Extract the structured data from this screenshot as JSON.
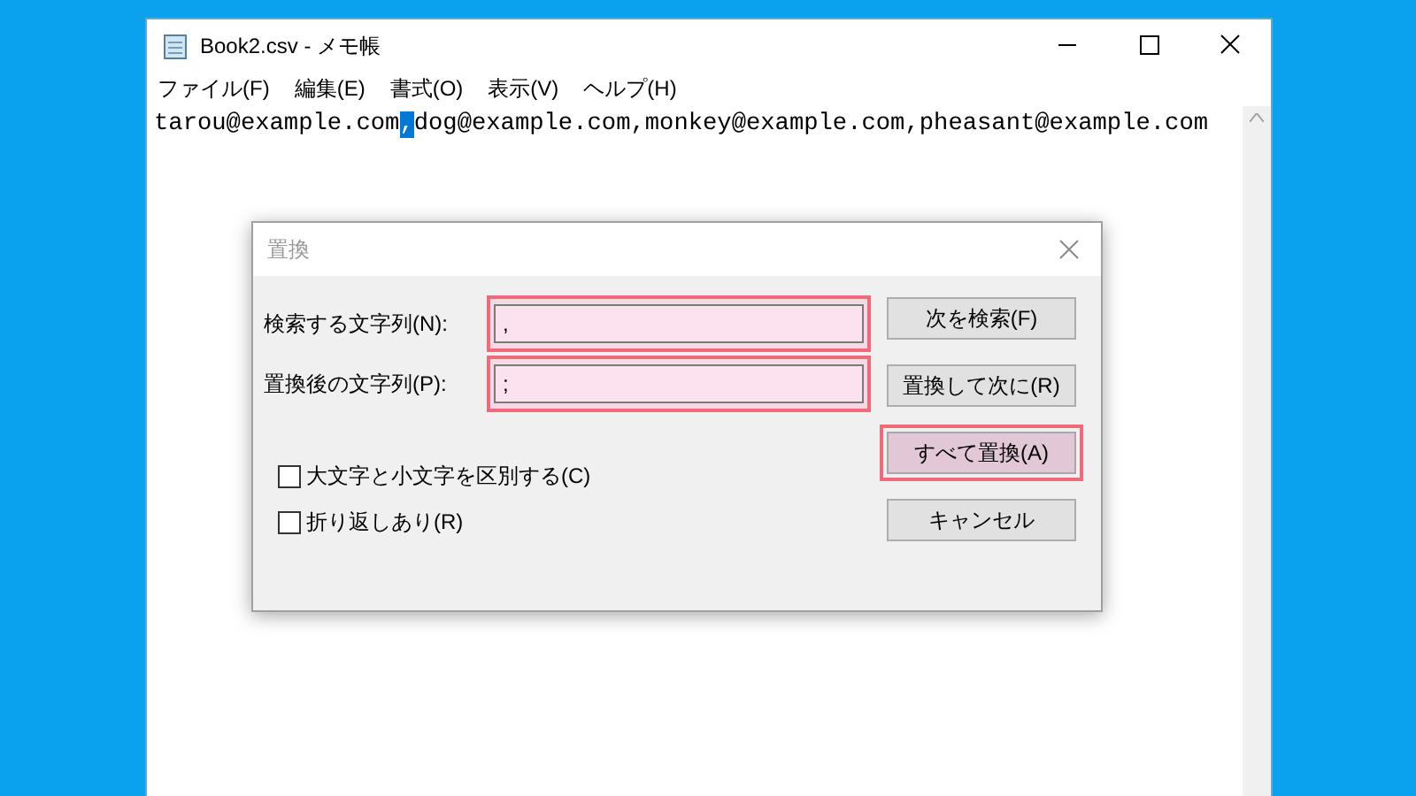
{
  "window": {
    "title": "Book2.csv - メモ帳"
  },
  "menu": [
    {
      "label": "ファイル(F)"
    },
    {
      "label": "編集(E)"
    },
    {
      "label": "書式(O)"
    },
    {
      "label": "表示(V)"
    },
    {
      "label": "ヘルプ(H)"
    }
  ],
  "editor": {
    "text_before": "tarou@example.com",
    "selection": ",",
    "text_after": "dog@example.com,monkey@example.com,pheasant@example.com"
  },
  "dialog": {
    "title": "置換",
    "fields": [
      {
        "label": "検索する文字列(N):",
        "value": ",",
        "highlighted": true
      },
      {
        "label": "置換後の文字列(P):",
        "value": ";",
        "highlighted": true
      }
    ],
    "buttons": [
      {
        "label": "次を検索(F)",
        "highlighted": false
      },
      {
        "label": "置換して次に(R)",
        "highlighted": false
      },
      {
        "label": "すべて置換(A)",
        "highlighted": true
      },
      {
        "label": "キャンセル",
        "highlighted": false
      }
    ],
    "checkboxes": [
      {
        "label": "大文字と小文字を区別する(C)",
        "checked": false
      },
      {
        "label": "折り返しあり(R)",
        "checked": false
      }
    ]
  }
}
